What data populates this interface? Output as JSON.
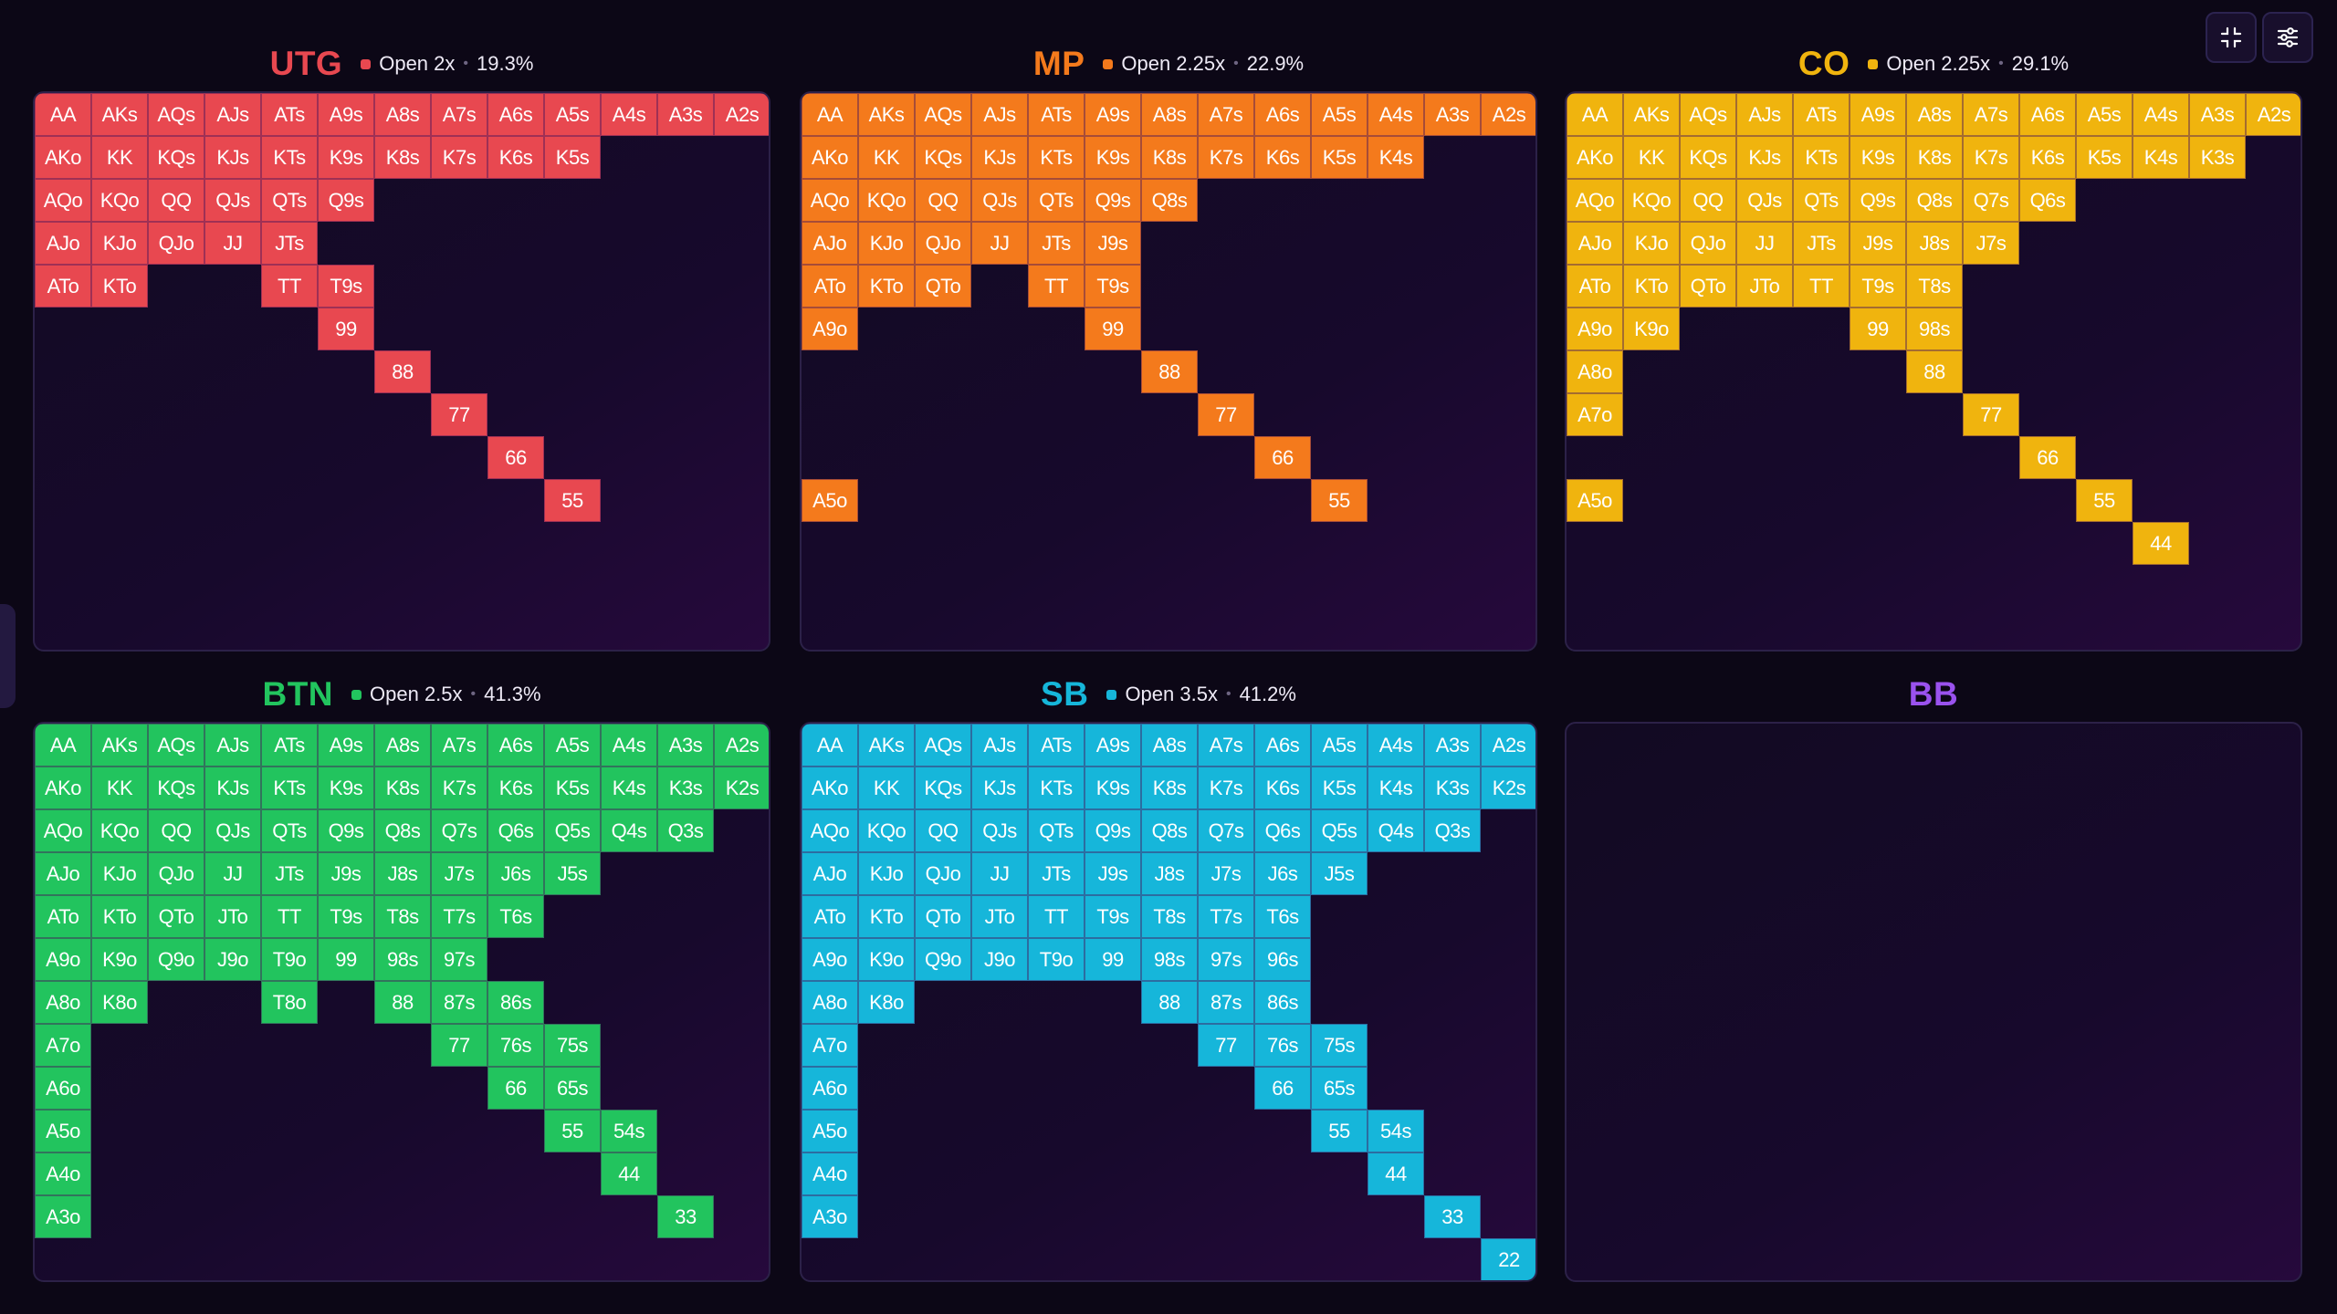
{
  "controls": {
    "collapse_icon": "collapse-icon",
    "settings_icon": "sliders-icon"
  },
  "panels": [
    {
      "id": "utg",
      "position": "UTG",
      "open_size": "Open 2x",
      "range_pct": "19.3%",
      "color": "#e84850",
      "hands": [
        "AA",
        "AKs",
        "AQs",
        "AJs",
        "ATs",
        "A9s",
        "A8s",
        "A7s",
        "A6s",
        "A5s",
        "A4s",
        "A3s",
        "A2s",
        "AKo",
        "KK",
        "KQs",
        "KJs",
        "KTs",
        "K9s",
        "K8s",
        "K7s",
        "K6s",
        "K5s",
        "AQo",
        "KQo",
        "QQ",
        "QJs",
        "QTs",
        "Q9s",
        "AJo",
        "KJo",
        "QJo",
        "JJ",
        "JTs",
        "ATo",
        "KTo",
        "TT",
        "T9s",
        "99",
        "88",
        "77",
        "66",
        "55"
      ]
    },
    {
      "id": "mp",
      "position": "MP",
      "open_size": "Open 2.25x",
      "range_pct": "22.9%",
      "color": "#f47a1c",
      "hands": [
        "AA",
        "AKs",
        "AQs",
        "AJs",
        "ATs",
        "A9s",
        "A8s",
        "A7s",
        "A6s",
        "A5s",
        "A4s",
        "A3s",
        "A2s",
        "AKo",
        "KK",
        "KQs",
        "KJs",
        "KTs",
        "K9s",
        "K8s",
        "K7s",
        "K6s",
        "K5s",
        "K4s",
        "AQo",
        "KQo",
        "QQ",
        "QJs",
        "QTs",
        "Q9s",
        "Q8s",
        "AJo",
        "KJo",
        "QJo",
        "JJ",
        "JTs",
        "J9s",
        "ATo",
        "KTo",
        "QTo",
        "TT",
        "T9s",
        "A9o",
        "99",
        "88",
        "77",
        "66",
        "A5o",
        "55"
      ]
    },
    {
      "id": "co",
      "position": "CO",
      "open_size": "Open 2.25x",
      "range_pct": "29.1%",
      "color": "#f0b40e",
      "hands": [
        "AA",
        "AKs",
        "AQs",
        "AJs",
        "ATs",
        "A9s",
        "A8s",
        "A7s",
        "A6s",
        "A5s",
        "A4s",
        "A3s",
        "A2s",
        "AKo",
        "KK",
        "KQs",
        "KJs",
        "KTs",
        "K9s",
        "K8s",
        "K7s",
        "K6s",
        "K5s",
        "K4s",
        "K3s",
        "AQo",
        "KQo",
        "QQ",
        "QJs",
        "QTs",
        "Q9s",
        "Q8s",
        "Q7s",
        "Q6s",
        "AJo",
        "KJo",
        "QJo",
        "JJ",
        "JTs",
        "J9s",
        "J8s",
        "J7s",
        "ATo",
        "KTo",
        "QTo",
        "JTo",
        "TT",
        "T9s",
        "T8s",
        "A9o",
        "K9o",
        "99",
        "98s",
        "A8o",
        "88",
        "A7o",
        "77",
        "66",
        "A5o",
        "55",
        "44"
      ]
    },
    {
      "id": "btn",
      "position": "BTN",
      "open_size": "Open 2.5x",
      "range_pct": "41.3%",
      "color": "#22c45e",
      "hands": [
        "AA",
        "AKs",
        "AQs",
        "AJs",
        "ATs",
        "A9s",
        "A8s",
        "A7s",
        "A6s",
        "A5s",
        "A4s",
        "A3s",
        "A2s",
        "AKo",
        "KK",
        "KQs",
        "KJs",
        "KTs",
        "K9s",
        "K8s",
        "K7s",
        "K6s",
        "K5s",
        "K4s",
        "K3s",
        "K2s",
        "AQo",
        "KQo",
        "QQ",
        "QJs",
        "QTs",
        "Q9s",
        "Q8s",
        "Q7s",
        "Q6s",
        "Q5s",
        "Q4s",
        "Q3s",
        "AJo",
        "KJo",
        "QJo",
        "JJ",
        "JTs",
        "J9s",
        "J8s",
        "J7s",
        "J6s",
        "J5s",
        "ATo",
        "KTo",
        "QTo",
        "JTo",
        "TT",
        "T9s",
        "T8s",
        "T7s",
        "T6s",
        "A9o",
        "K9o",
        "Q9o",
        "J9o",
        "T9o",
        "99",
        "98s",
        "97s",
        "A8o",
        "K8o",
        "T8o",
        "88",
        "87s",
        "86s",
        "A7o",
        "77",
        "76s",
        "75s",
        "A6o",
        "66",
        "65s",
        "A5o",
        "55",
        "54s",
        "A4o",
        "44",
        "A3o",
        "33"
      ]
    },
    {
      "id": "sb",
      "position": "SB",
      "open_size": "Open 3.5x",
      "range_pct": "41.2%",
      "color": "#16b6da",
      "hands": [
        "AA",
        "AKs",
        "AQs",
        "AJs",
        "ATs",
        "A9s",
        "A8s",
        "A7s",
        "A6s",
        "A5s",
        "A4s",
        "A3s",
        "A2s",
        "AKo",
        "KK",
        "KQs",
        "KJs",
        "KTs",
        "K9s",
        "K8s",
        "K7s",
        "K6s",
        "K5s",
        "K4s",
        "K3s",
        "K2s",
        "AQo",
        "KQo",
        "QQ",
        "QJs",
        "QTs",
        "Q9s",
        "Q8s",
        "Q7s",
        "Q6s",
        "Q5s",
        "Q4s",
        "Q3s",
        "AJo",
        "KJo",
        "QJo",
        "JJ",
        "JTs",
        "J9s",
        "J8s",
        "J7s",
        "J6s",
        "J5s",
        "ATo",
        "KTo",
        "QTo",
        "JTo",
        "TT",
        "T9s",
        "T8s",
        "T7s",
        "T6s",
        "A9o",
        "K9o",
        "Q9o",
        "J9o",
        "T9o",
        "99",
        "98s",
        "97s",
        "96s",
        "A8o",
        "K8o",
        "88",
        "87s",
        "86s",
        "A7o",
        "77",
        "76s",
        "75s",
        "A6o",
        "66",
        "65s",
        "A5o",
        "55",
        "54s",
        "A4o",
        "44",
        "A3o",
        "33",
        "22"
      ]
    },
    {
      "id": "bb",
      "position": "BB",
      "open_size": "",
      "range_pct": "",
      "color": "#9a52ee",
      "hands": []
    }
  ]
}
